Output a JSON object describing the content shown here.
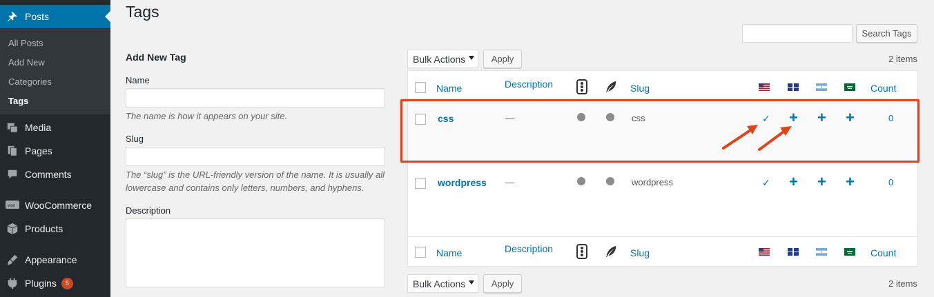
{
  "sidebar": {
    "posts": "Posts",
    "sub": [
      "All Posts",
      "Add New",
      "Categories",
      "Tags"
    ],
    "media": "Media",
    "pages": "Pages",
    "comments": "Comments",
    "woocommerce": "WooCommerce",
    "products": "Products",
    "appearance": "Appearance",
    "plugins": "Plugins",
    "plugins_badge": "5"
  },
  "page": {
    "title": "Tags",
    "search_button": "Search Tags"
  },
  "form": {
    "heading": "Add New Tag",
    "name_label": "Name",
    "name_help": "The name is how it appears on your site.",
    "slug_label": "Slug",
    "slug_help": "The “slug” is the URL-friendly version of the name. It is usually all lowercase and contains only letters, numbers, and hyphens.",
    "description_label": "Description"
  },
  "list": {
    "bulk_actions": "Bulk Actions",
    "apply": "Apply",
    "items_count": "2 items",
    "columns": {
      "name": "Name",
      "description": "Description",
      "slug": "Slug",
      "count": "Count"
    },
    "rows": [
      {
        "name": "css",
        "description": "—",
        "slug": "css",
        "count": "0"
      },
      {
        "name": "wordpress",
        "description": "—",
        "slug": "wordpress",
        "count": "0"
      }
    ]
  },
  "colors": {
    "accent": "#0073aa",
    "sidebar": "#23282d",
    "highlight": "#e0441c"
  }
}
